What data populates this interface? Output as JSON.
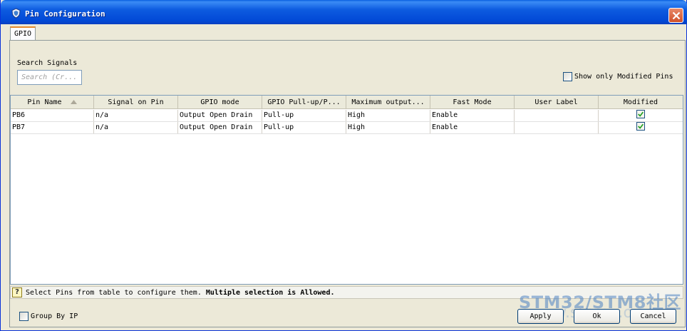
{
  "window": {
    "title": "Pin Configuration"
  },
  "tabs": [
    {
      "label": "GPIO"
    }
  ],
  "search": {
    "label": "Search Signals",
    "placeholder": "Search (Cr..."
  },
  "show_modified": {
    "label": "Show only Modified Pins",
    "checked": false
  },
  "table": {
    "columns": [
      "Pin Name",
      "Signal on Pin",
      "GPIO mode",
      "GPIO Pull-up/P...",
      "Maximum output...",
      "Fast Mode",
      "User Label",
      "Modified"
    ],
    "sort_column": "Pin Name",
    "rows": [
      {
        "pin": "PB6",
        "signal": "n/a",
        "mode": "Output Open Drain",
        "pull": "Pull-up",
        "max_output": "High",
        "fast_mode": "Enable",
        "user_label": "",
        "modified": true
      },
      {
        "pin": "PB7",
        "signal": "n/a",
        "mode": "Output Open Drain",
        "pull": "Pull-up",
        "max_output": "High",
        "fast_mode": "Enable",
        "user_label": "",
        "modified": true
      }
    ]
  },
  "status": {
    "prefix": "Select Pins from table to configure them. ",
    "bold": "Multiple selection is Allowed."
  },
  "group_by_ip": {
    "label": "Group By IP",
    "checked": false
  },
  "buttons": {
    "apply": "Apply",
    "ok": "Ok",
    "cancel": "Cancel"
  },
  "watermark": {
    "text": "STM32/STM8社区",
    "url_text": "www.stmcu.org"
  },
  "colors": {
    "titlebar": "#0249d6",
    "accent_tab": "#e68b2c",
    "check": "#21a121"
  }
}
